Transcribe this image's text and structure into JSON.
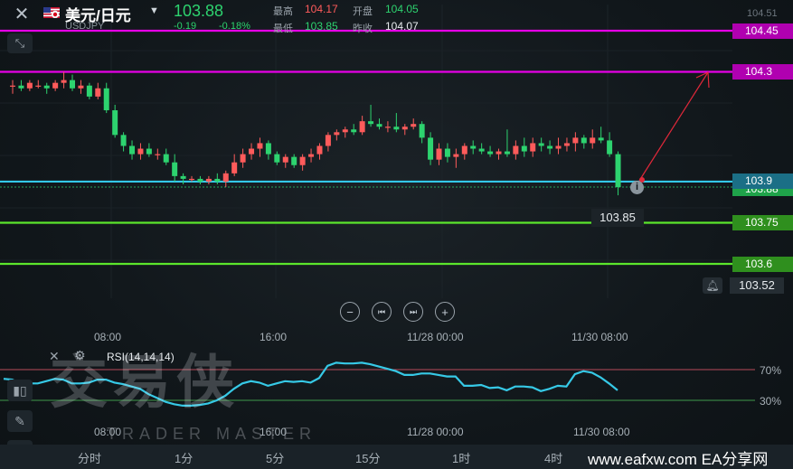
{
  "header": {
    "close_icon": "close-icon",
    "symbol_name": "美元/日元",
    "symbol_code": "USDJPY",
    "price": "103.88",
    "change": "-0.19",
    "change_pct": "-0.18%",
    "high_label": "最高",
    "high_value": "104.17",
    "open_label": "开盘",
    "open_value": "104.05",
    "low_label": "最低",
    "low_value": "103.85",
    "prevclose_label": "昨收",
    "prevclose_value": "104.07"
  },
  "price_axis": {
    "top_label": "104.51",
    "last_price_label": "103.88",
    "bell_price": "103.52"
  },
  "hlines": [
    {
      "price": "104.45",
      "color": "#e600e6"
    },
    {
      "price": "104.3",
      "color": "#e600e6"
    },
    {
      "price": "103.9",
      "color": "#33c8e8"
    },
    {
      "price": "103.75",
      "color": "#5be62c"
    },
    {
      "price": "103.6",
      "color": "#5be62c"
    }
  ],
  "low_marker": "103.85",
  "time_axis_top": [
    "08:00",
    "16:00",
    "11/28 00:00",
    "11/30 08:00"
  ],
  "time_axis_bottom": [
    "08:00",
    "16:00",
    "11/28 00:00",
    "11/30 08:00"
  ],
  "rsi": {
    "label": "RSI(14,14,14)",
    "upper": "70%",
    "lower": "30%",
    "values": [
      58,
      57,
      52,
      52,
      52,
      55,
      58,
      57,
      52,
      52,
      53,
      57,
      57,
      53,
      51,
      48,
      45,
      38,
      33,
      28,
      25,
      23,
      23,
      24,
      26,
      30,
      36,
      45,
      52,
      55,
      53,
      49,
      52,
      55,
      54,
      55,
      53,
      59,
      75,
      79,
      78,
      78,
      79,
      77,
      74,
      71,
      68,
      63,
      63,
      65,
      65,
      63,
      61,
      61,
      49,
      49,
      50,
      46,
      47,
      43,
      48,
      48,
      47,
      42,
      45,
      49,
      48,
      64,
      68,
      66,
      60,
      52,
      43
    ]
  },
  "timeframes": [
    "分时",
    "1分",
    "5分",
    "15分",
    "1时",
    "4时"
  ],
  "watermark": "交易侠",
  "watermark_sub": "TRADER MASTER",
  "site_text": "www.eafxw.com  EA分享网",
  "colors": {
    "up": "#ff5b5b",
    "down": "#2dd36f",
    "rsi": "#36c9e6"
  },
  "candles": [
    {
      "o": 104.25,
      "h": 104.27,
      "l": 104.22,
      "c": 104.25
    },
    {
      "o": 104.25,
      "h": 104.27,
      "l": 104.23,
      "c": 104.24
    },
    {
      "o": 104.24,
      "h": 104.27,
      "l": 104.23,
      "c": 104.26
    },
    {
      "o": 104.25,
      "h": 104.27,
      "l": 104.24,
      "c": 104.25
    },
    {
      "o": 104.25,
      "h": 104.26,
      "l": 104.22,
      "c": 104.24
    },
    {
      "o": 104.24,
      "h": 104.27,
      "l": 104.23,
      "c": 104.26
    },
    {
      "o": 104.26,
      "h": 104.3,
      "l": 104.24,
      "c": 104.27
    },
    {
      "o": 104.27,
      "h": 104.29,
      "l": 104.23,
      "c": 104.24
    },
    {
      "o": 104.24,
      "h": 104.27,
      "l": 104.22,
      "c": 104.25
    },
    {
      "o": 104.25,
      "h": 104.26,
      "l": 104.2,
      "c": 104.21
    },
    {
      "o": 104.21,
      "h": 104.26,
      "l": 104.2,
      "c": 104.24
    },
    {
      "o": 104.24,
      "h": 104.26,
      "l": 104.15,
      "c": 104.16
    },
    {
      "o": 104.16,
      "h": 104.18,
      "l": 104.06,
      "c": 104.07
    },
    {
      "o": 104.07,
      "h": 104.08,
      "l": 104.01,
      "c": 104.03
    },
    {
      "o": 104.03,
      "h": 104.05,
      "l": 103.98,
      "c": 104.0
    },
    {
      "o": 104.0,
      "h": 104.04,
      "l": 103.98,
      "c": 104.02
    },
    {
      "o": 104.02,
      "h": 104.04,
      "l": 103.99,
      "c": 104.0
    },
    {
      "o": 104.0,
      "h": 104.02,
      "l": 103.98,
      "c": 104.0
    },
    {
      "o": 104.0,
      "h": 104.02,
      "l": 103.96,
      "c": 103.97
    },
    {
      "o": 103.97,
      "h": 104.0,
      "l": 103.9,
      "c": 103.92
    },
    {
      "o": 103.92,
      "h": 103.93,
      "l": 103.89,
      "c": 103.91
    },
    {
      "o": 103.91,
      "h": 103.92,
      "l": 103.9,
      "c": 103.91
    },
    {
      "o": 103.91,
      "h": 103.92,
      "l": 103.89,
      "c": 103.9
    },
    {
      "o": 103.9,
      "h": 103.92,
      "l": 103.89,
      "c": 103.91
    },
    {
      "o": 103.91,
      "h": 103.93,
      "l": 103.89,
      "c": 103.9
    },
    {
      "o": 103.9,
      "h": 103.94,
      "l": 103.88,
      "c": 103.93
    },
    {
      "o": 103.93,
      "h": 104.0,
      "l": 103.92,
      "c": 103.97
    },
    {
      "o": 103.97,
      "h": 104.02,
      "l": 103.95,
      "c": 104.0
    },
    {
      "o": 104.0,
      "h": 104.04,
      "l": 103.98,
      "c": 104.02
    },
    {
      "o": 104.02,
      "h": 104.06,
      "l": 103.99,
      "c": 104.04
    },
    {
      "o": 104.04,
      "h": 104.05,
      "l": 103.98,
      "c": 104.0
    },
    {
      "o": 104.0,
      "h": 104.01,
      "l": 103.96,
      "c": 103.97
    },
    {
      "o": 103.97,
      "h": 104.0,
      "l": 103.95,
      "c": 103.99
    },
    {
      "o": 103.99,
      "h": 104.0,
      "l": 103.95,
      "c": 103.96
    },
    {
      "o": 103.96,
      "h": 104.0,
      "l": 103.94,
      "c": 103.99
    },
    {
      "o": 103.99,
      "h": 104.02,
      "l": 103.97,
      "c": 104.0
    },
    {
      "o": 104.0,
      "h": 104.04,
      "l": 103.98,
      "c": 104.03
    },
    {
      "o": 104.03,
      "h": 104.08,
      "l": 104.01,
      "c": 104.07
    },
    {
      "o": 104.07,
      "h": 104.09,
      "l": 104.05,
      "c": 104.08
    },
    {
      "o": 104.08,
      "h": 104.1,
      "l": 104.06,
      "c": 104.09
    },
    {
      "o": 104.09,
      "h": 104.11,
      "l": 104.07,
      "c": 104.08
    },
    {
      "o": 104.08,
      "h": 104.14,
      "l": 104.07,
      "c": 104.12
    },
    {
      "o": 104.12,
      "h": 104.18,
      "l": 104.1,
      "c": 104.11
    },
    {
      "o": 104.11,
      "h": 104.13,
      "l": 104.09,
      "c": 104.1
    },
    {
      "o": 104.1,
      "h": 104.12,
      "l": 104.08,
      "c": 104.1
    },
    {
      "o": 104.1,
      "h": 104.15,
      "l": 104.08,
      "c": 104.09
    },
    {
      "o": 104.09,
      "h": 104.11,
      "l": 104.07,
      "c": 104.1
    },
    {
      "o": 104.1,
      "h": 104.13,
      "l": 104.09,
      "c": 104.11
    },
    {
      "o": 104.11,
      "h": 104.12,
      "l": 104.04,
      "c": 104.06
    },
    {
      "o": 104.06,
      "h": 104.08,
      "l": 103.96,
      "c": 103.98
    },
    {
      "o": 103.98,
      "h": 104.04,
      "l": 103.96,
      "c": 104.02
    },
    {
      "o": 104.02,
      "h": 104.04,
      "l": 103.97,
      "c": 103.99
    },
    {
      "o": 103.99,
      "h": 104.02,
      "l": 103.95,
      "c": 104.0
    },
    {
      "o": 104.0,
      "h": 104.04,
      "l": 103.98,
      "c": 104.03
    },
    {
      "o": 104.03,
      "h": 104.05,
      "l": 104.0,
      "c": 104.02
    },
    {
      "o": 104.02,
      "h": 104.04,
      "l": 104.0,
      "c": 104.01
    },
    {
      "o": 104.01,
      "h": 104.03,
      "l": 103.99,
      "c": 104.0
    },
    {
      "o": 104.0,
      "h": 104.02,
      "l": 103.98,
      "c": 104.01
    },
    {
      "o": 104.01,
      "h": 104.09,
      "l": 103.99,
      "c": 104.0
    },
    {
      "o": 104.0,
      "h": 104.05,
      "l": 103.98,
      "c": 104.03
    },
    {
      "o": 104.03,
      "h": 104.06,
      "l": 103.99,
      "c": 104.01
    },
    {
      "o": 104.01,
      "h": 104.06,
      "l": 103.99,
      "c": 104.04
    },
    {
      "o": 104.04,
      "h": 104.06,
      "l": 104.01,
      "c": 104.03
    },
    {
      "o": 104.03,
      "h": 104.05,
      "l": 104.0,
      "c": 104.02
    },
    {
      "o": 104.02,
      "h": 104.06,
      "l": 104.0,
      "c": 104.03
    },
    {
      "o": 104.03,
      "h": 104.06,
      "l": 104.01,
      "c": 104.04
    },
    {
      "o": 104.04,
      "h": 104.08,
      "l": 104.01,
      "c": 104.06
    },
    {
      "o": 104.06,
      "h": 104.07,
      "l": 104.02,
      "c": 104.04
    },
    {
      "o": 104.04,
      "h": 104.09,
      "l": 104.02,
      "c": 104.06
    },
    {
      "o": 104.06,
      "h": 104.1,
      "l": 104.04,
      "c": 104.05
    },
    {
      "o": 104.05,
      "h": 104.08,
      "l": 103.99,
      "c": 104.0
    },
    {
      "o": 104.0,
      "h": 104.01,
      "l": 103.85,
      "c": 103.88
    }
  ]
}
